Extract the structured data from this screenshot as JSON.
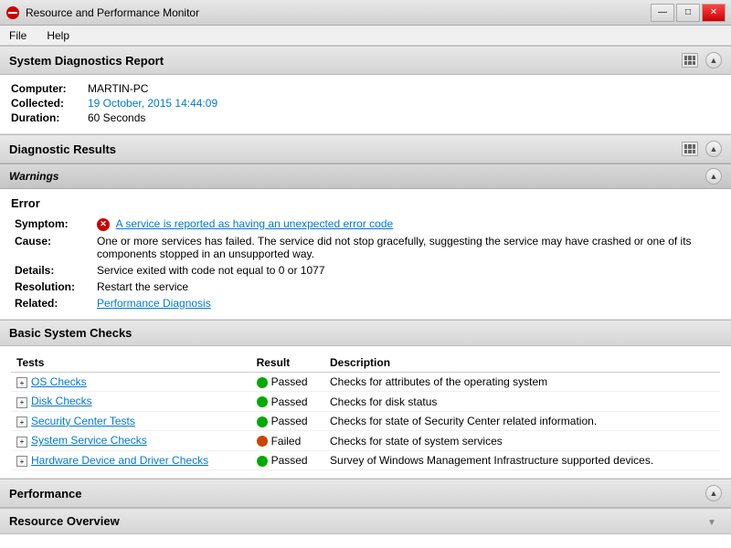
{
  "titleBar": {
    "title": "Resource and Performance Monitor",
    "controls": {
      "minimize": "—",
      "maximize": "□",
      "close": "✕"
    }
  },
  "menuBar": {
    "items": [
      "File",
      "Help"
    ]
  },
  "systemDiagnostics": {
    "sectionTitle": "System Diagnostics Report",
    "computer_label": "Computer:",
    "computer_value": "MARTIN-PC",
    "collected_label": "Collected:",
    "collected_value": "19 October, 2015 14:44:09",
    "duration_label": "Duration:",
    "duration_value": "60 Seconds"
  },
  "diagnosticResults": {
    "sectionTitle": "Diagnostic Results"
  },
  "warnings": {
    "title": "Warnings"
  },
  "error": {
    "title": "Error",
    "symptom_label": "Symptom:",
    "symptom_link": "A service is reported as having an unexpected error code",
    "cause_label": "Cause:",
    "cause_value": "One or more services has failed. The service did not stop gracefully, suggesting the service may have crashed or one of its components stopped in an unsupported way.",
    "details_label": "Details:",
    "details_value": "Service exited with code not equal to 0 or 1077",
    "resolution_label": "Resolution:",
    "resolution_value": "Restart the service",
    "related_label": "Related:",
    "related_link": "Performance Diagnosis"
  },
  "basicSystemChecks": {
    "title": "Basic System Checks",
    "columns": [
      "Tests",
      "Result",
      "Description"
    ],
    "rows": [
      {
        "name": "OS Checks",
        "result": "Passed",
        "status": "green",
        "description": "Checks for attributes of the operating system"
      },
      {
        "name": "Disk Checks",
        "result": "Passed",
        "status": "green",
        "description": "Checks for disk status"
      },
      {
        "name": "Security Center Tests",
        "result": "Passed",
        "status": "green",
        "description": "Checks for state of Security Center related information."
      },
      {
        "name": "System Service Checks",
        "result": "Failed",
        "status": "red",
        "description": "Checks for state of system services"
      },
      {
        "name": "Hardware Device and Driver Checks",
        "result": "Passed",
        "status": "green",
        "description": "Survey of Windows Management Infrastructure supported devices."
      }
    ]
  },
  "performance": {
    "title": "Performance"
  },
  "resourceOverview": {
    "title": "Resource Overview"
  },
  "icons": {
    "collapse": "▲",
    "expand": "▼",
    "plus": "+",
    "error": "✕"
  }
}
